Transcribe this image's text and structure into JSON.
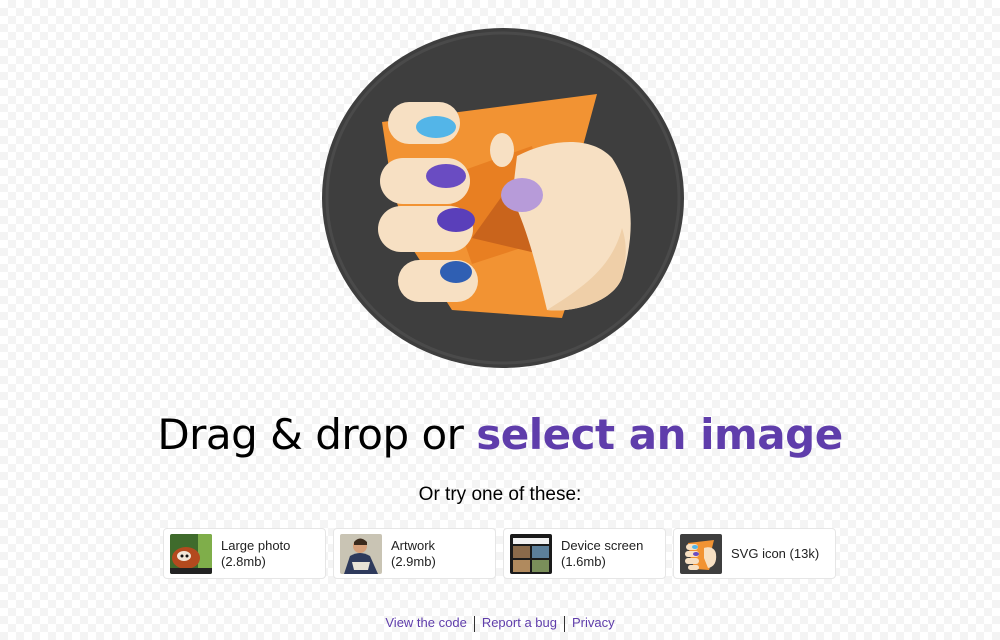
{
  "headline": {
    "prefix": "Drag & drop or ",
    "link": "select an image"
  },
  "subhead": "Or try one of these:",
  "demos": [
    {
      "title": "Large photo",
      "size": "(2.8mb)",
      "icon": "red-panda-photo"
    },
    {
      "title": "Artwork",
      "size": "(2.9mb)",
      "icon": "artwork-painting"
    },
    {
      "title": "Device screen",
      "size": "(1.6mb)",
      "icon": "device-screenshot"
    },
    {
      "title": "SVG icon (13k)",
      "size": "",
      "icon": "squoosh-logo"
    }
  ],
  "footer": {
    "links": [
      "View the code",
      "Report a bug",
      "Privacy"
    ]
  },
  "colors": {
    "accent": "#5f3dab",
    "logo_circle": "#3e3e3e",
    "logo_orange": "#f29333"
  }
}
